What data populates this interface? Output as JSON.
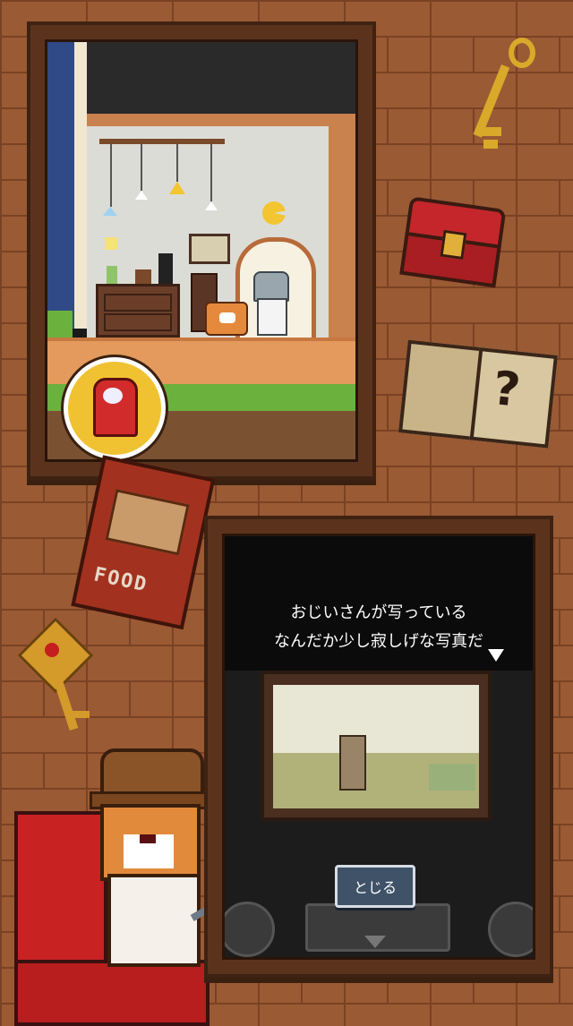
{
  "dialog": {
    "line1": "おじいさんが写っている",
    "line2": "なんだか少し寂しげな写真だ",
    "close_label": "とじる"
  },
  "items": {
    "food_label": "FOOD"
  },
  "icons": [
    "golden-key-icon",
    "treasure-chest-icon",
    "mystery-book-icon",
    "dog-food-bag-icon",
    "ornate-key-icon",
    "gacha-coin-icon",
    "down-arrow-icon"
  ],
  "colors": {
    "brick": "#9a5a34",
    "frame": "#5b331c",
    "button": "#3f5268"
  }
}
